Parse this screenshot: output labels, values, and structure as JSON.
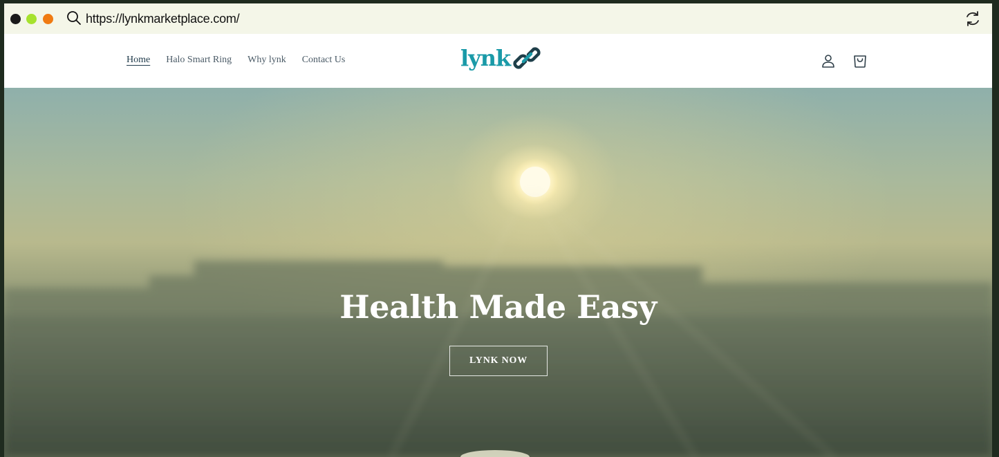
{
  "browser": {
    "url": "https://lynkmarketplace.com/"
  },
  "header": {
    "nav": [
      {
        "label": "Home",
        "active": true
      },
      {
        "label": "Halo Smart Ring",
        "active": false
      },
      {
        "label": "Why lynk",
        "active": false
      },
      {
        "label": "Contact Us",
        "active": false
      }
    ],
    "logo_text": "lynk",
    "icons": [
      "link-icon",
      "account-icon",
      "cart-icon"
    ]
  },
  "hero": {
    "title": "Health Made Easy",
    "button_label": "LYNK NOW"
  },
  "colors": {
    "brand": "#1a9aa8",
    "logo_link": "#1f3f4a",
    "chrome_bg": "#f4f6e8",
    "frame_bg": "#1f2b1f"
  }
}
